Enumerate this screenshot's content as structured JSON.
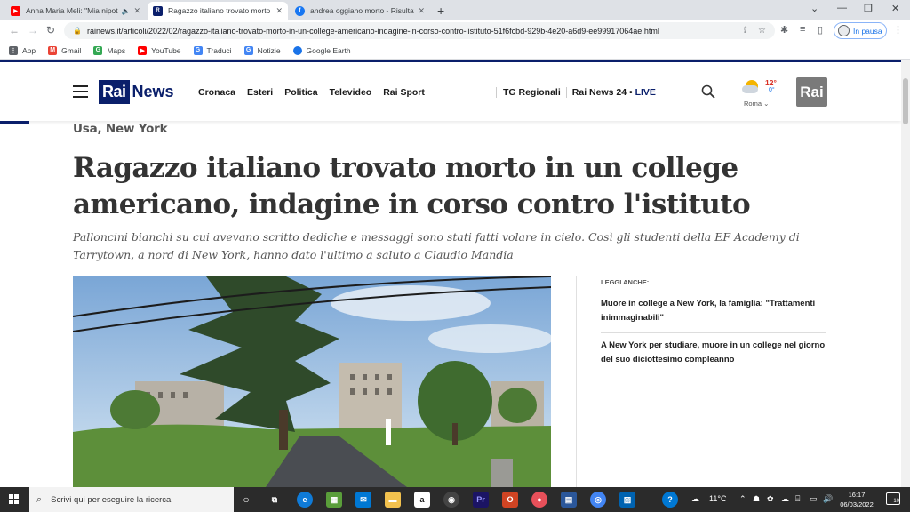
{
  "browser": {
    "tabs": [
      {
        "title": "Anna Maria Meli: \"Mia nipote...",
        "favicon": "youtube-icon",
        "color": "#ff0000"
      },
      {
        "title": "Ragazzo italiano trovato morto i...",
        "favicon": "rai-icon",
        "color": "#0a1f6b"
      },
      {
        "title": "andrea oggiano morto - Risultati...",
        "favicon": "facebook-icon",
        "color": "#1877f2"
      }
    ],
    "url": "rainews.it/articoli/2022/02/ragazzo-italiano-trovato-morto-in-un-college-americano-indagine-in-corso-contro-listituto-51f6fcbd-929b-4e20-a6d9-ee99917064ae.html",
    "profile_status": "In pausa",
    "bookmarks": [
      {
        "label": "App",
        "icon": "apps-grid-icon",
        "color": "#5f6368"
      },
      {
        "label": "Gmail",
        "icon": "gmail-icon",
        "color": "#ea4335"
      },
      {
        "label": "Maps",
        "icon": "maps-icon",
        "color": "#34a853"
      },
      {
        "label": "YouTube",
        "icon": "youtube-icon",
        "color": "#ff0000"
      },
      {
        "label": "Traduci",
        "icon": "translate-icon",
        "color": "#4285f4"
      },
      {
        "label": "Notizie",
        "icon": "news-icon",
        "color": "#4285f4"
      },
      {
        "label": "Google Earth",
        "icon": "earth-icon",
        "color": "#1a73e8"
      }
    ]
  },
  "site": {
    "logo_rai": "Rai",
    "logo_news": "News",
    "nav": [
      "Cronaca",
      "Esteri",
      "Politica",
      "Televideo",
      "Rai Sport"
    ],
    "subnav_tg": "TG Regionali",
    "subnav_news24": "Rai News 24 •",
    "subnav_live": "LIVE",
    "weather": {
      "max": "12°",
      "min": "0°",
      "city": "Roma"
    },
    "rai_badge": "Rai",
    "brand_color": "#0a1f6b"
  },
  "article": {
    "kicker": "Usa, New York",
    "headline": "Ragazzo italiano trovato morto in un college americano, indagine in corso contro l'istituto",
    "summary": "Palloncini bianchi su cui avevano scritto dediche e messaggi sono stati fatti volare in cielo. Così gli studenti della EF Academy di Tarrytown, a nord di New York, hanno dato l'ultimo a saluto a Claudio Mandia",
    "read_also_label": "LEGGI ANCHE:",
    "read_also": [
      "Muore in college a New York, la famiglia: \"Trattamenti inimmaginabili\"",
      "A New York per studiare, muore in un college nel giorno del suo diciottesimo compleanno"
    ]
  },
  "taskbar": {
    "search_placeholder": "Scrivi qui per eseguire la ricerca",
    "temperature": "11°C",
    "time": "16:17",
    "date": "06/03/2022",
    "notifications": "10"
  }
}
